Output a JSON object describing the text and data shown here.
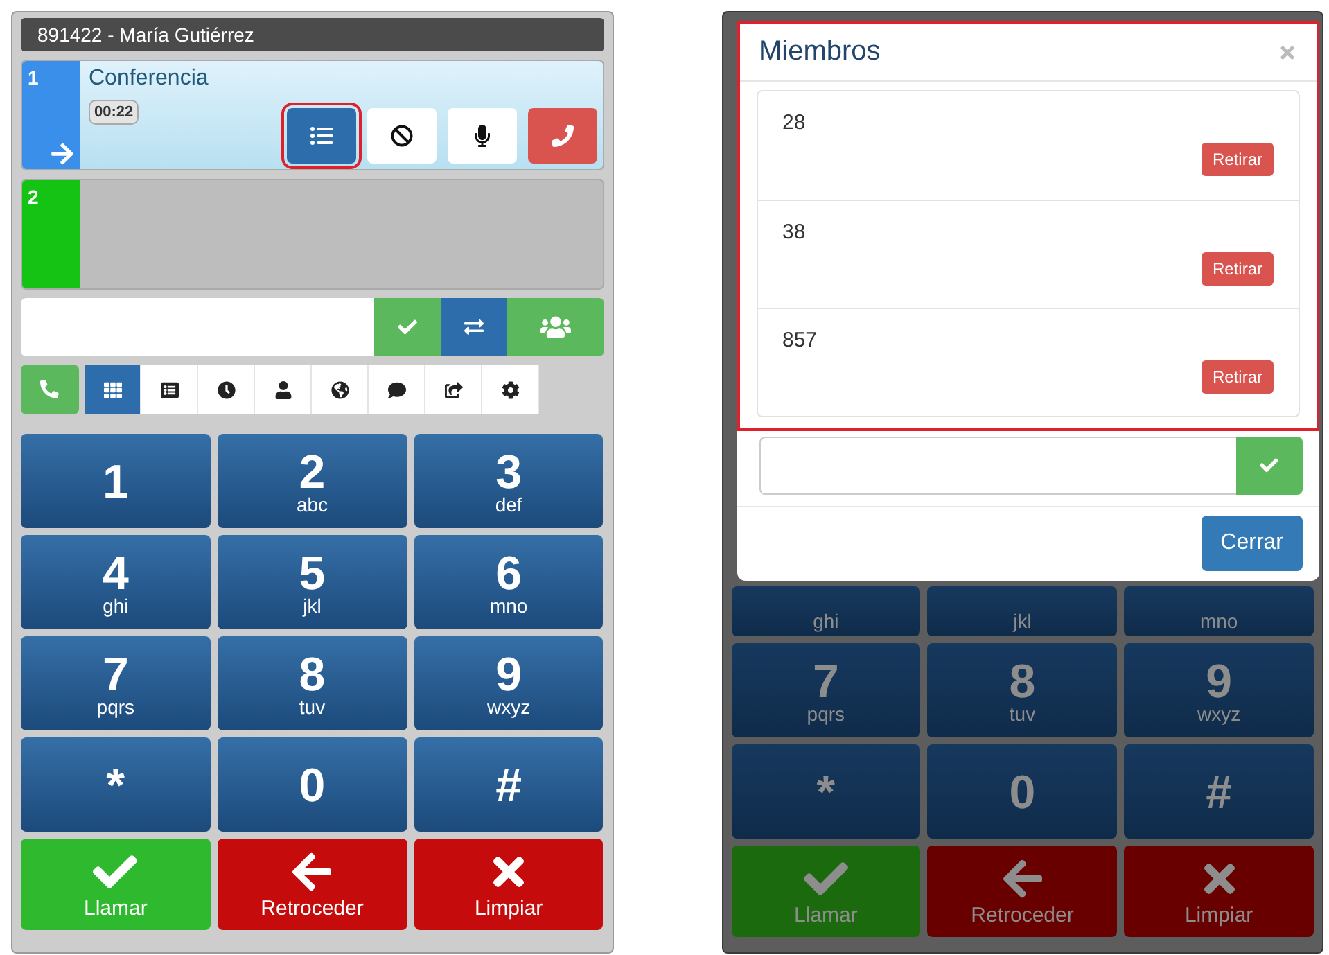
{
  "phone": {
    "title": "891422 - María Gutiérrez",
    "lines": [
      {
        "number": "1",
        "active": true,
        "color": "#3a8fea",
        "label": "Conferencia",
        "timer": "00:22"
      },
      {
        "number": "2",
        "active": false,
        "color": "#14c314"
      }
    ],
    "line_actions": [
      {
        "kind": "members",
        "selected": true,
        "highlighted": true
      },
      {
        "kind": "block",
        "selected": false,
        "highlighted": false
      },
      {
        "kind": "mute",
        "selected": false,
        "highlighted": false
      },
      {
        "kind": "hangup",
        "selected": false,
        "highlighted": false
      }
    ],
    "dial_buttons": [
      {
        "kind": "confirm"
      },
      {
        "kind": "transfer"
      },
      {
        "kind": "conference"
      }
    ],
    "tabs": [
      {
        "kind": "keypad",
        "selected": true
      },
      {
        "kind": "list",
        "selected": false
      },
      {
        "kind": "history",
        "selected": false
      },
      {
        "kind": "contact",
        "selected": false
      },
      {
        "kind": "web",
        "selected": false
      },
      {
        "kind": "chat",
        "selected": false
      },
      {
        "kind": "forward",
        "selected": false
      },
      {
        "kind": "settings",
        "selected": false
      }
    ],
    "keys": [
      {
        "digit": "1"
      },
      {
        "digit": "2",
        "letters": "abc"
      },
      {
        "digit": "3",
        "letters": "def"
      },
      {
        "digit": "4",
        "letters": "ghi"
      },
      {
        "digit": "5",
        "letters": "jkl"
      },
      {
        "digit": "6",
        "letters": "mno"
      },
      {
        "digit": "7",
        "letters": "pqrs"
      },
      {
        "digit": "8",
        "letters": "tuv"
      },
      {
        "digit": "9",
        "letters": "wxyz"
      },
      {
        "digit": "*"
      },
      {
        "digit": "0"
      },
      {
        "digit": "#"
      }
    ],
    "actions": [
      {
        "kind": "call",
        "label": "Llamar"
      },
      {
        "kind": "back",
        "label": "Retroceder"
      },
      {
        "kind": "clear",
        "label": "Limpiar"
      }
    ]
  },
  "dimmed_phone": {
    "modal": {
      "title": "Miembros",
      "highlighted": true,
      "members": [
        {
          "number": "28",
          "button": "Retirar"
        },
        {
          "number": "38",
          "button": "Retirar"
        },
        {
          "number": "857",
          "button": "Retirar"
        }
      ],
      "close_button": "Cerrar"
    },
    "partial_keys": [
      {
        "letters": "ghi"
      },
      {
        "letters": "jkl"
      },
      {
        "letters": "mno"
      }
    ],
    "keys": [
      {
        "digit": "7",
        "letters": "pqrs"
      },
      {
        "digit": "8",
        "letters": "tuv"
      },
      {
        "digit": "9",
        "letters": "wxyz"
      },
      {
        "digit": "*"
      },
      {
        "digit": "0"
      },
      {
        "digit": "#"
      }
    ],
    "actions": [
      {
        "kind": "call",
        "label": "Llamar"
      },
      {
        "kind": "back",
        "label": "Retroceder"
      },
      {
        "kind": "clear",
        "label": "Limpiar"
      }
    ]
  }
}
